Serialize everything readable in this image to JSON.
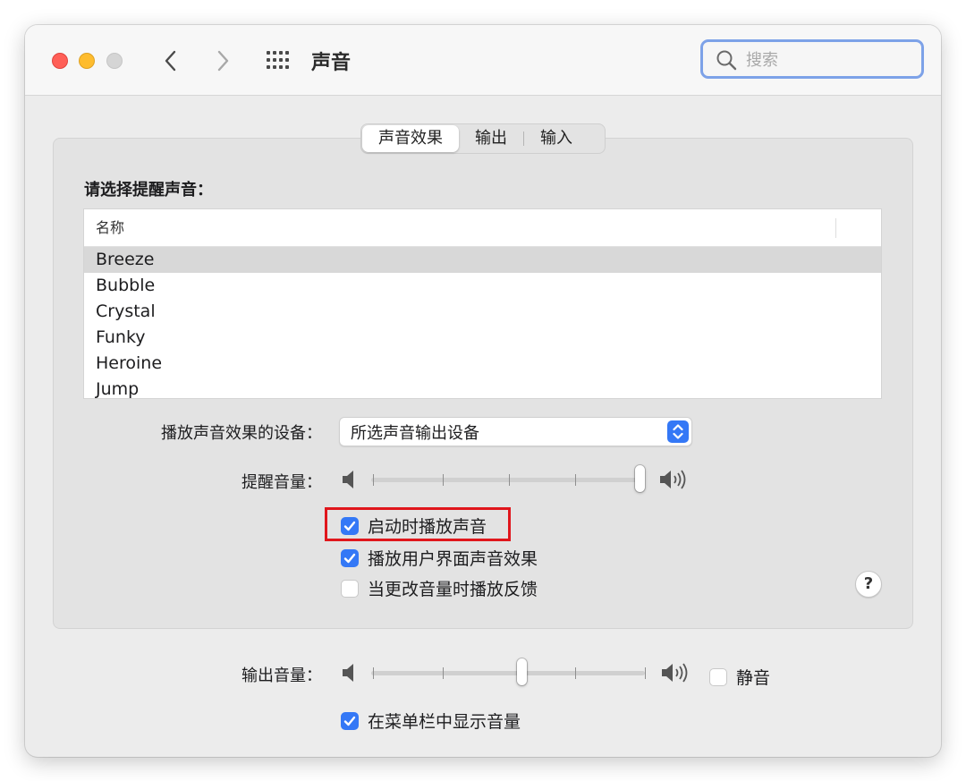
{
  "window": {
    "title": "声音"
  },
  "search": {
    "placeholder": "搜索"
  },
  "tabs": [
    {
      "label": "声音效果",
      "active": true
    },
    {
      "label": "输出",
      "active": false
    },
    {
      "label": "输入",
      "active": false
    }
  ],
  "sound_effects": {
    "alert_label": "请选择提醒声音：",
    "column_header": "名称",
    "sounds": [
      "Breeze",
      "Bubble",
      "Crystal",
      "Funky",
      "Heroine",
      "Jump"
    ],
    "selected_sound": "Breeze",
    "device_label": "播放声音效果的设备：",
    "device_value": "所选声音输出设备",
    "alert_volume_label": "提醒音量：",
    "alert_volume": 1.0,
    "checkboxes": [
      {
        "label": "启动时播放声音",
        "checked": true
      },
      {
        "label": "播放用户界面声音效果",
        "checked": true
      },
      {
        "label": "当更改音量时播放反馈",
        "checked": false
      }
    ],
    "help": "?"
  },
  "output": {
    "volume_label": "输出音量：",
    "volume": 0.5,
    "mute_label": "静音",
    "mute_checked": false,
    "menubar_label": "在菜单栏中显示音量",
    "menubar_checked": true
  },
  "colors": {
    "accent": "#3478f6",
    "highlight_border": "#e0161c",
    "close": "#ff5f57",
    "minimize": "#febc2e",
    "zoom_disabled": "#d5d5d5"
  },
  "icons": [
    "back-chevron-icon",
    "forward-chevron-icon",
    "grid-icon",
    "search-icon",
    "speaker-low-icon",
    "speaker-high-icon",
    "checkmark-icon",
    "updown-chevron-icon"
  ]
}
